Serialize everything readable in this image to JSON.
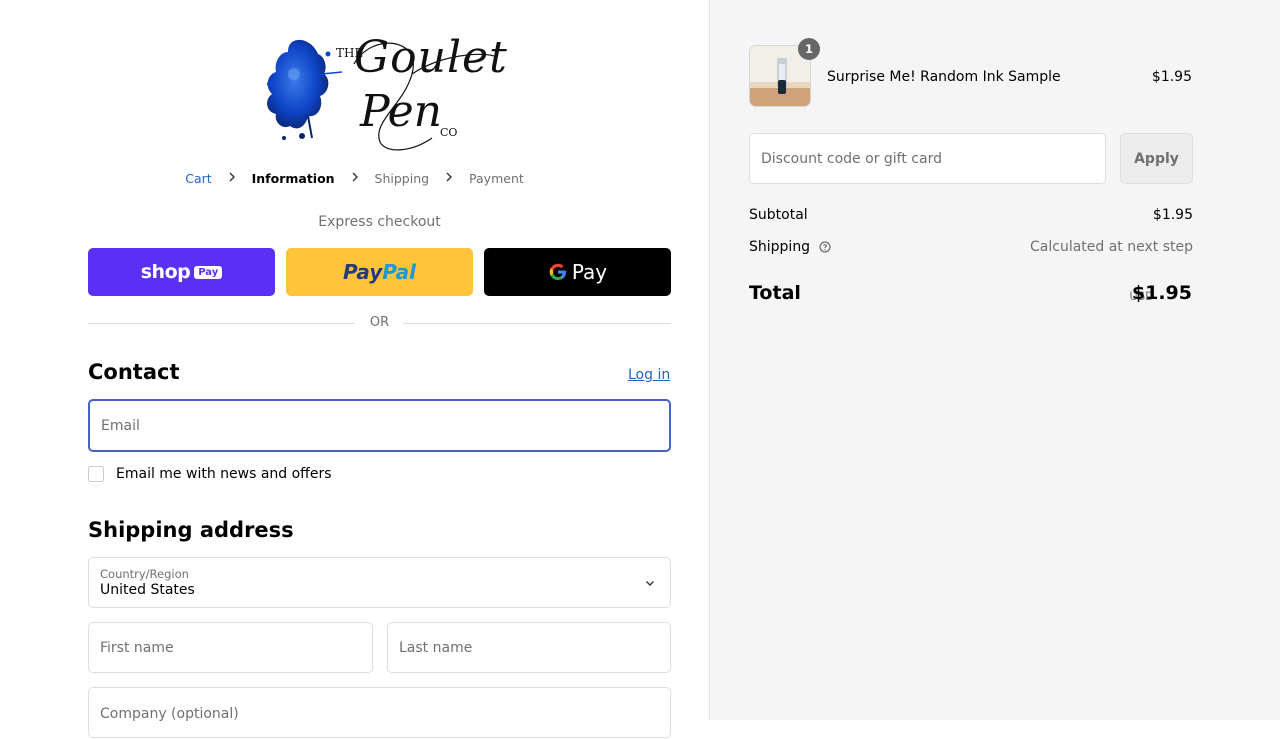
{
  "logo": {
    "the": "THE",
    "word1": "Goulet",
    "word2": "Pen",
    "co": "CO"
  },
  "breadcrumb": {
    "cart": "Cart",
    "information": "Information",
    "shipping": "Shipping",
    "payment": "Payment"
  },
  "express": {
    "label": "Express checkout",
    "shoppay_word": "shop",
    "shoppay_pill": "Pay",
    "paypal_pay": "Pay",
    "paypal_pal": "Pal",
    "gpay_word": "Pay"
  },
  "or_text": "OR",
  "contact": {
    "heading": "Contact",
    "login_label": "Log in",
    "email_placeholder": "Email",
    "news_label": "Email me with news and offers"
  },
  "shipping": {
    "heading": "Shipping address",
    "country_label": "Country/Region",
    "country_value": "United States",
    "first_name_placeholder": "First name",
    "last_name_placeholder": "Last name",
    "company_placeholder": "Company (optional)"
  },
  "order": {
    "quantity": "1",
    "item_name": "Surprise Me! Random Ink Sample",
    "item_price": "$1.95",
    "discount_placeholder": "Discount code or gift card",
    "apply_label": "Apply",
    "subtotal_label": "Subtotal",
    "subtotal_value": "$1.95",
    "shipping_label": "Shipping",
    "shipping_value": "Calculated at next step",
    "total_label": "Total",
    "currency": "USD",
    "total_value": "$1.95"
  },
  "colors": {
    "accent": "#4762c6",
    "link": "#1f63c6",
    "shoppay": "#5a31f4",
    "paypal": "#ffc439",
    "gpay": "#000000"
  }
}
